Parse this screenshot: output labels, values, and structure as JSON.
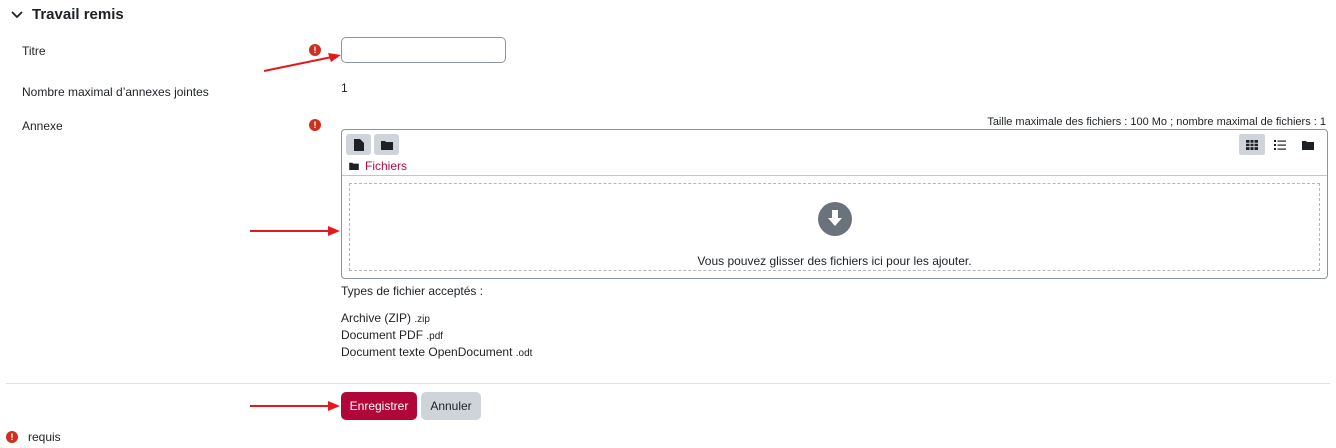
{
  "section": {
    "title": "Travail remis"
  },
  "fields": {
    "title": {
      "label": "Titre",
      "value": ""
    },
    "max_attachments": {
      "label": "Nombre maximal d’annexes jointes",
      "value": "1"
    },
    "attachment": {
      "label": "Annexe"
    }
  },
  "filemanager": {
    "limits": "Taille maximale des fichiers : 100 Mo ; nombre maximal de fichiers : 1",
    "path_label": "Fichiers",
    "drop_text": "Vous pouvez glisser des fichiers ici pour les ajouter.",
    "toolbar_icons": [
      "add-file-icon",
      "create-folder-icon"
    ],
    "view_icons": [
      "grid-view-icon",
      "list-view-icon",
      "folder-view-icon"
    ]
  },
  "accepted": {
    "heading": "Types de fichier acceptés :",
    "types": [
      {
        "name": "Archive (ZIP)",
        "ext": ".zip"
      },
      {
        "name": "Document PDF",
        "ext": ".pdf"
      },
      {
        "name": "Document texte OpenDocument",
        "ext": ".odt"
      }
    ]
  },
  "buttons": {
    "save": "Enregistrer",
    "cancel": "Annuler"
  },
  "legend": {
    "required_label": "requis"
  },
  "colors": {
    "required": "#ca3120",
    "primary": "#b1063a",
    "annotation_arrow": "#e5191c"
  }
}
